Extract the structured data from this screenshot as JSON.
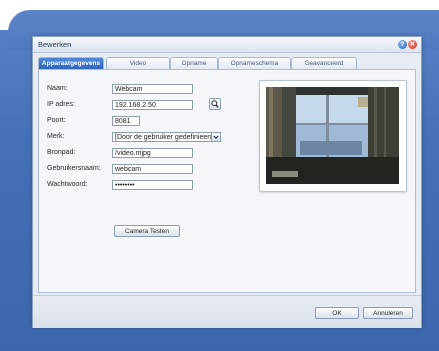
{
  "window": {
    "title": "Bewerken",
    "help_glyph": "?",
    "close_glyph": "✕"
  },
  "tabs": [
    {
      "label": "Apparaatgegevens",
      "active": true
    },
    {
      "label": "Video",
      "active": false
    },
    {
      "label": "Opname",
      "active": false
    },
    {
      "label": "Opnameschema",
      "active": false
    },
    {
      "label": "Geavanceerd",
      "active": false
    }
  ],
  "form": {
    "name_label": "Naam:",
    "name_value": "Webcam",
    "ip_label": "IP adres:",
    "ip_value": "192.168.2.50",
    "port_label": "Poort:",
    "port_value": "8081",
    "brand_label": "Merk:",
    "brand_value": "[Door de gebruiker gedefinieerd]",
    "source_label": "Bronpad:",
    "source_value": "/video.mjpg",
    "user_label": "Gebruikersnaam:",
    "user_value": "webcam",
    "password_label": "Wachtwoord:",
    "password_value": "••••••••",
    "test_button": "Camera Testen"
  },
  "footer": {
    "ok_label": "OK",
    "cancel_label": "Annuleren"
  },
  "icons": {
    "search": "search-icon",
    "dropdown": "chevron-down-icon",
    "help": "help-icon",
    "close": "close-icon"
  },
  "colors": {
    "active_tab": "#2d63b8",
    "desktop": "#4470b8"
  }
}
